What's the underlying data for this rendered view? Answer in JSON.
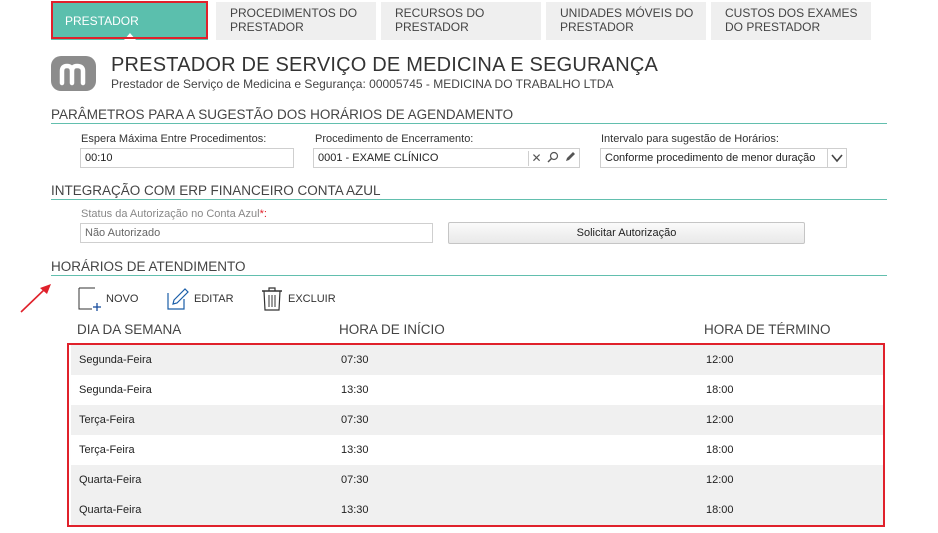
{
  "tabs": [
    {
      "label_line1": "PRESTADOR",
      "label_line2": ""
    },
    {
      "label_line1": "PROCEDIMENTOS DO",
      "label_line2": "PRESTADOR"
    },
    {
      "label_line1": "RECURSOS DO",
      "label_line2": "PRESTADOR"
    },
    {
      "label_line1": "UNIDADES MÓVEIS DO",
      "label_line2": "PRESTADOR"
    },
    {
      "label_line1": "CUSTOS DOS EXAMES",
      "label_line2": "DO PRESTADOR"
    }
  ],
  "header": {
    "title": "PRESTADOR DE SERVIÇO DE MEDICINA E SEGURANÇA",
    "subtitle": "Prestador de Serviço de Medicina e Segurança: 00005745 - MEDICINA DO TRABALHO LTDA"
  },
  "params": {
    "section_title": "PARÂMETROS PARA A SUGESTÃO DOS HORÁRIOS DE AGENDAMENTO",
    "espera_label": "Espera Máxima Entre Procedimentos:",
    "espera_value": "00:10",
    "procedimento_label": "Procedimento de Encerramento:",
    "procedimento_value": "0001 - EXAME CLÍNICO",
    "intervalo_label": "Intervalo para sugestão de Horários:",
    "intervalo_value": "Conforme procedimento de menor duração"
  },
  "integracao": {
    "section_title": "INTEGRAÇÃO COM ERP FINANCEIRO CONTA AZUL",
    "status_label": "Status da Autorização no Conta Azul",
    "status_required": "*:",
    "status_value": "Não Autorizado",
    "solicitar_button": "Solicitar Autorização"
  },
  "horarios": {
    "section_title": "HORÁRIOS DE ATENDIMENTO",
    "toolbar": {
      "novo": "NOVO",
      "editar": "EDITAR",
      "excluir": "EXCLUIR"
    },
    "columns": [
      "DIA DA SEMANA",
      "HORA DE INÍCIO",
      "HORA DE TÉRMINO"
    ],
    "rows": [
      {
        "dia": "Segunda-Feira",
        "inicio": "07:30",
        "termino": "12:00"
      },
      {
        "dia": "Segunda-Feira",
        "inicio": "13:30",
        "termino": "18:00"
      },
      {
        "dia": "Terça-Feira",
        "inicio": "07:30",
        "termino": "12:00"
      },
      {
        "dia": "Terça-Feira",
        "inicio": "13:30",
        "termino": "18:00"
      },
      {
        "dia": "Quarta-Feira",
        "inicio": "07:30",
        "termino": "12:00"
      },
      {
        "dia": "Quarta-Feira",
        "inicio": "13:30",
        "termino": "18:00"
      }
    ]
  },
  "colors": {
    "accent": "#5bbfad",
    "highlight": "#e0212b",
    "logo": "#8c8c8c"
  },
  "icons": [
    "new-record-icon",
    "edit-icon",
    "trash-icon",
    "clear-icon",
    "search-icon",
    "pencil-icon",
    "chevron-down-icon",
    "arrow-annotation-icon"
  ]
}
